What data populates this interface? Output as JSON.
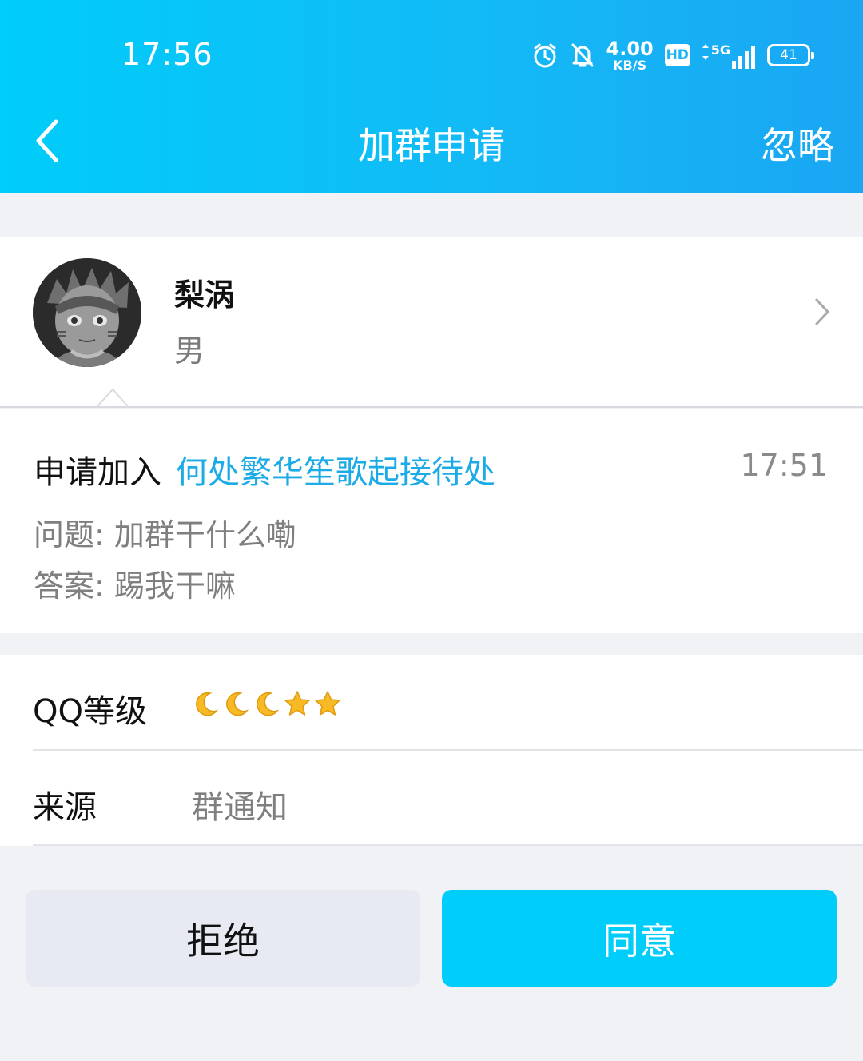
{
  "status_bar": {
    "time": "17:56",
    "net_speed_value": "4.00",
    "net_speed_unit": "KB/S",
    "hd_label": "HD",
    "network_label": "5G",
    "battery": "41",
    "icons": [
      "alarm-icon",
      "bell-muted-icon",
      "network-arrows-icon",
      "signal-bars-icon",
      "battery-icon"
    ]
  },
  "nav": {
    "title": "加群申请",
    "ignore_label": "忽略",
    "back_icon": "chevron-left-icon"
  },
  "user": {
    "name": "梨涡",
    "gender": "男"
  },
  "request": {
    "label": "申请加入",
    "group_name": "何处繁华笙歌起接待处",
    "time": "17:51",
    "question_label": "问题:",
    "question": "加群干什么嘞",
    "answer_label": "答案:",
    "answer": "踢我干嘛"
  },
  "info": {
    "level_label": "QQ等级",
    "level_icons": [
      "moon",
      "moon",
      "moon",
      "star",
      "star"
    ],
    "source_label": "来源",
    "source_value": "群通知"
  },
  "buttons": {
    "reject": "拒绝",
    "accept": "同意"
  },
  "colors": {
    "header_gradient_start": "#00cdf9",
    "header_gradient_end": "#1aa6f3",
    "accent_link": "#1cabe6",
    "accept_button": "#00cdf9",
    "reject_button": "#e7eaf2",
    "background": "#f1f2f6"
  }
}
